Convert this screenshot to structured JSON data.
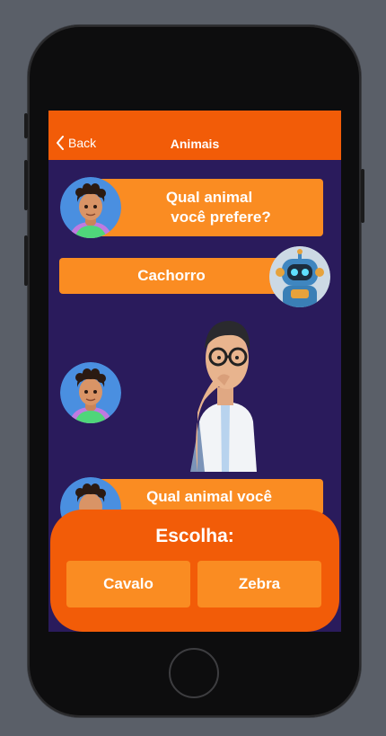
{
  "navbar": {
    "back_label": "Back",
    "title": "Animais"
  },
  "chat": {
    "question1": [
      "Qual animal",
      "você prefere?"
    ],
    "answer1": "Cachorro",
    "question2_partial": "Qual animal você"
  },
  "choices": {
    "title": "Escolha:",
    "options": [
      "Cavalo",
      "Zebra"
    ]
  },
  "colors": {
    "accent": "#f25c08",
    "bubble": "#fa8c22",
    "background": "#2a1b5c"
  }
}
